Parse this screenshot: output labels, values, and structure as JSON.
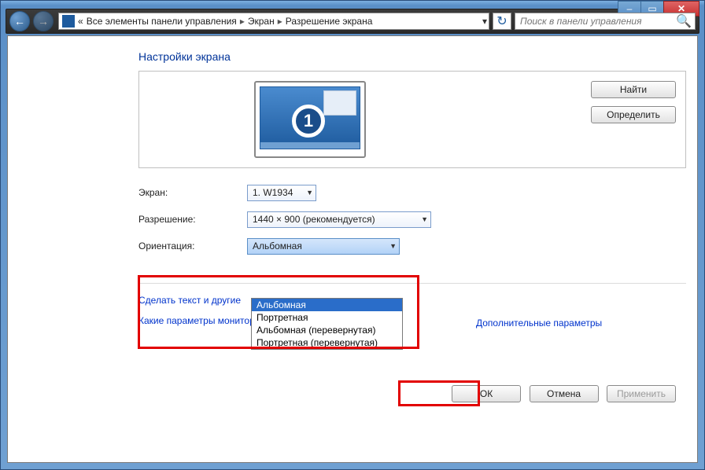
{
  "window": {
    "min": "–",
    "max": "▭",
    "close": "✕"
  },
  "breadcrumb": {
    "chevron_back": "«",
    "root": "Все элементы панели управления",
    "mid": "Экран",
    "leaf": "Разрешение экрана"
  },
  "search": {
    "placeholder": "Поиск в панели управления"
  },
  "page": {
    "title": "Настройки экрана",
    "find": "Найти",
    "identify": "Определить",
    "screen_label": "Экран:",
    "screen_value": "1. W1934",
    "res_label": "Разрешение:",
    "res_value": "1440 × 900 (рекомендуется)",
    "orient_label": "Ориентация:",
    "orient_value": "Альбомная",
    "orient_options": [
      "Альбомная",
      "Портретная",
      "Альбомная (перевернутая)",
      "Портретная (перевернутая)"
    ],
    "advanced": "Дополнительные параметры",
    "link_text1": "Сделать текст и другие",
    "link_text2": "Какие параметры монитора следует выбрать?",
    "ok": "ОК",
    "cancel": "Отмена",
    "apply": "Применить"
  }
}
